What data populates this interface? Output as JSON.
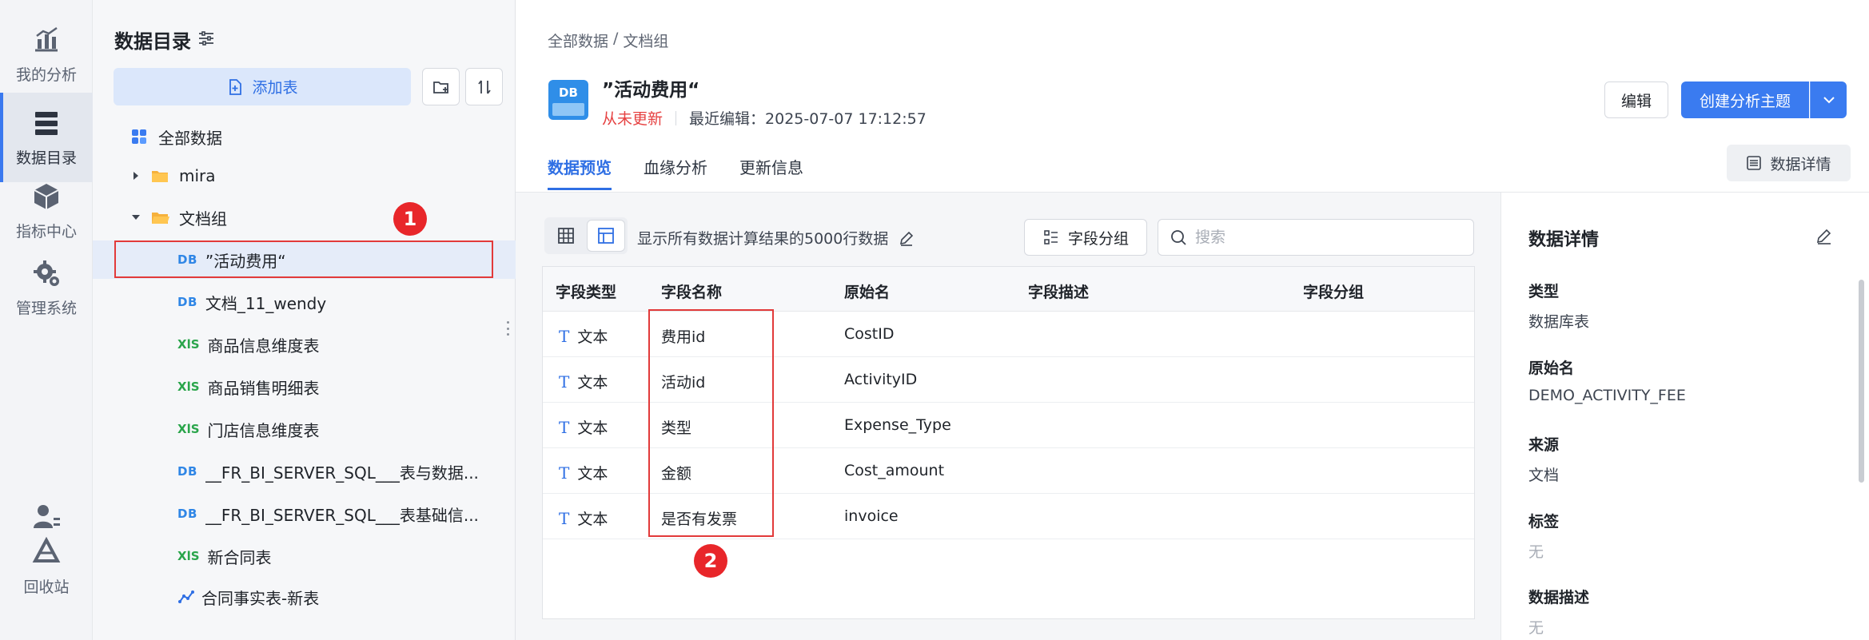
{
  "rail": {
    "items": [
      {
        "label": "我的分析",
        "icon": "chart-icon"
      },
      {
        "label": "数据目录",
        "icon": "database-icon"
      },
      {
        "label": "指标中心",
        "icon": "cube-icon"
      },
      {
        "label": "管理系统",
        "icon": "gear-icon"
      },
      {
        "label": "回收站",
        "icon": "recycle-icon"
      }
    ],
    "active": "数据目录"
  },
  "catalog": {
    "title": "数据目录",
    "add_table_label": "添加表",
    "tree": [
      {
        "label": "全部数据",
        "type": "all"
      },
      {
        "label": "mira",
        "type": "folder",
        "expanded": false
      },
      {
        "label": "文档组",
        "type": "folder",
        "expanded": true
      },
      {
        "label": "”活动费用“",
        "type": "DB",
        "selected": true
      },
      {
        "label": "文档_11_wendy",
        "type": "DB"
      },
      {
        "label": "商品信息维度表",
        "type": "XLS"
      },
      {
        "label": "商品销售明细表",
        "type": "XLS"
      },
      {
        "label": "门店信息维度表",
        "type": "XLS"
      },
      {
        "label": "__FR_BI_SERVER_SQL___表与数据...",
        "type": "DB"
      },
      {
        "label": "__FR_BI_SERVER_SQL___表基础信...",
        "type": "DB"
      },
      {
        "label": "新合同表",
        "type": "XLS"
      },
      {
        "label": "合同事实表-新表",
        "type": "ETL"
      }
    ],
    "type_badges": {
      "db": "DB",
      "xls": "XlS"
    }
  },
  "markers": {
    "one": "1",
    "two": "2"
  },
  "main": {
    "breadcrumb": {
      "root": "全部数据",
      "sep": "/",
      "current": "文档组"
    },
    "dataset_icon_text": "DB",
    "dataset_title": "”活动费用“",
    "status": "从未更新",
    "last_edited": "最近编辑：2025-07-07 17:12:57",
    "edit_label": "编辑",
    "create_label": "创建分析主题",
    "tabs": [
      "数据预览",
      "血缘分析",
      "更新信息"
    ],
    "active_tab": "数据预览",
    "detail_button_label": "数据详情",
    "rows_note": "显示所有数据计算结果的5000行数据",
    "group_button_label": "字段分组",
    "search_placeholder": "搜索"
  },
  "table": {
    "columns": [
      "字段类型",
      "字段名称",
      "原始名",
      "字段描述",
      "字段分组"
    ],
    "rows": [
      {
        "type": "文本",
        "name": "费用id",
        "original": "CostID",
        "desc": "",
        "group": ""
      },
      {
        "type": "文本",
        "name": "活动id",
        "original": "ActivityID",
        "desc": "",
        "group": ""
      },
      {
        "type": "文本",
        "name": "类型",
        "original": "Expense_Type",
        "desc": "",
        "group": ""
      },
      {
        "type": "文本",
        "name": "金额",
        "original": "Cost_amount",
        "desc": "",
        "group": ""
      },
      {
        "type": "文本",
        "name": "是否有发票",
        "original": "invoice",
        "desc": "",
        "group": ""
      }
    ],
    "type_glyph": "T"
  },
  "details": {
    "title": "数据详情",
    "fields": [
      {
        "label": "类型",
        "value": "数据库表"
      },
      {
        "label": "原始名",
        "value": "DEMO_ACTIVITY_FEE"
      },
      {
        "label": "来源",
        "value": "文档"
      },
      {
        "label": "标签",
        "value": "无"
      },
      {
        "label": "数据描述",
        "value": "无"
      }
    ]
  },
  "colors": {
    "accent": "#3a7bf0",
    "marker_red": "#e8262a",
    "stale_red": "#e64141"
  }
}
